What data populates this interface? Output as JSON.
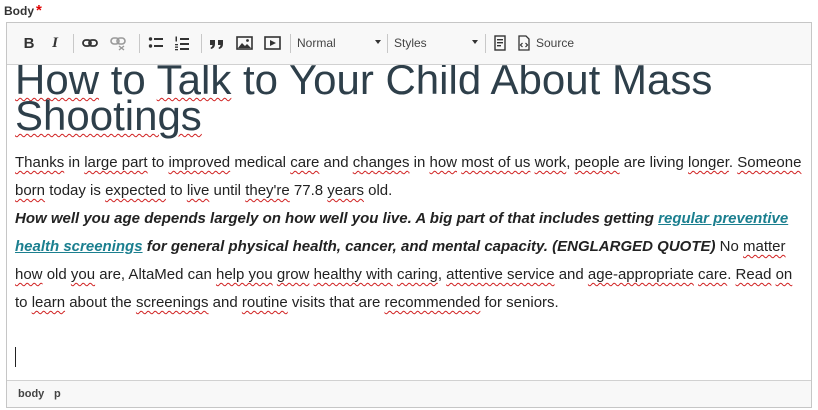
{
  "field": {
    "label": "Body",
    "required_mark": "*"
  },
  "toolbar": {
    "bold_label": "B",
    "italic_label": "I",
    "format_value": "Normal",
    "styles_value": "Styles",
    "source_label": "Source"
  },
  "content": {
    "heading": [
      "How",
      " to ",
      "Talk",
      " to Your Child About Mass ",
      "Shootings"
    ],
    "para1": [
      "Thanks",
      " in ",
      "large part",
      " to ",
      "improved",
      " medical ",
      "care",
      " and ",
      "changes",
      " in ",
      "how",
      " ",
      "most of us",
      " ",
      "work",
      ", ",
      "people",
      " are living ",
      "longer",
      ". ",
      "Someone",
      " ",
      "born",
      " today is ",
      "expected",
      " to ",
      "live",
      " until ",
      "they're",
      " 77.8 ",
      "years",
      " old."
    ],
    "quote_parts": [
      "How well you age depends largely on how well you live. A big part of that includes getting ",
      "regular preventive health screenings",
      " for general physical health, cancer, and mental capacity.  (ENGLARGED QUOTE)"
    ],
    "para2_tail": [
      " No ",
      "matter",
      " ",
      "how",
      " old ",
      "you",
      " are, AltaMed can ",
      "help you",
      " ",
      "grow",
      " ",
      "healthy with",
      " ",
      "caring",
      ", ",
      "attentive service",
      " and ",
      "age-appropriate",
      " ",
      "care",
      ". ",
      "Read",
      " ",
      "on",
      " to ",
      "learn",
      " about the ",
      "screenings",
      " and ",
      "routine",
      " visits that are ",
      "recommended",
      " for seniors."
    ]
  },
  "statusbar": {
    "crumbs": [
      "body",
      "p"
    ]
  }
}
